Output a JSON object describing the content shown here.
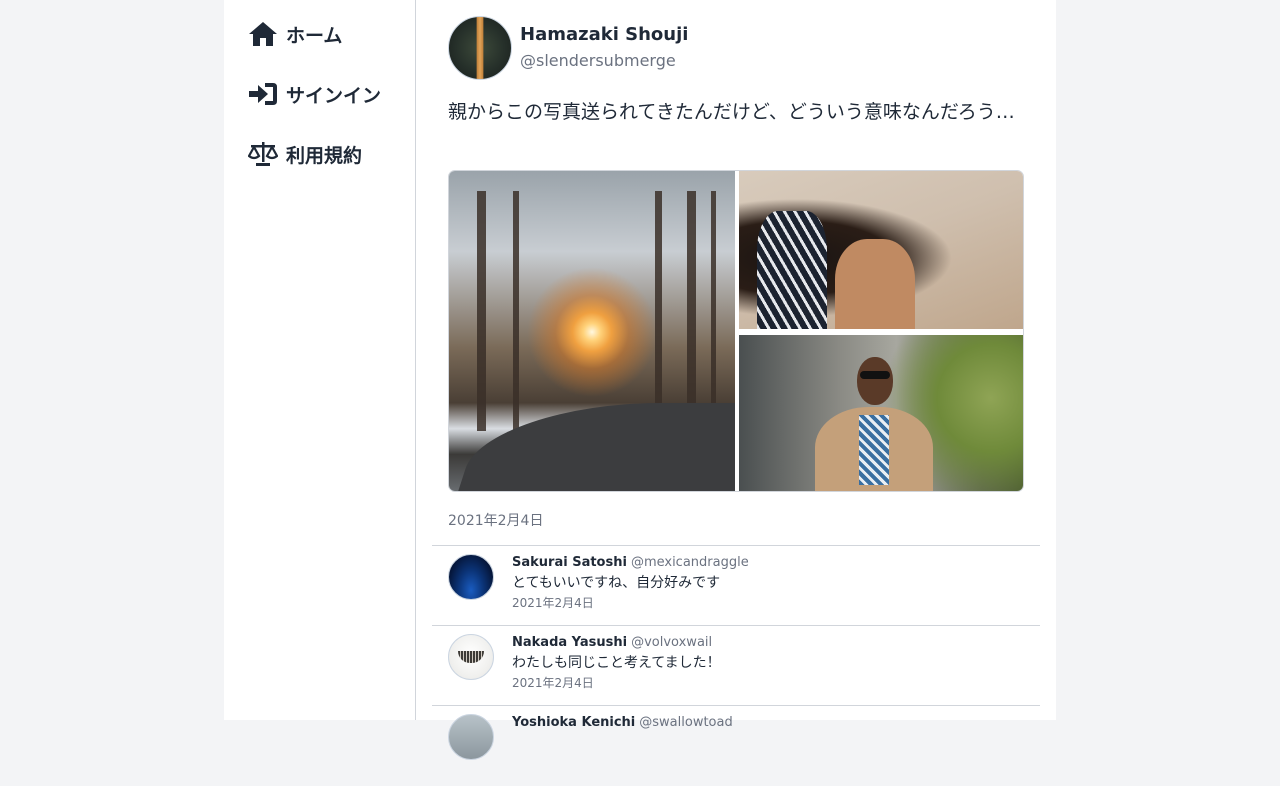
{
  "sidebar": {
    "items": [
      {
        "label": "ホーム",
        "icon": "home-icon"
      },
      {
        "label": "サインイン",
        "icon": "sign-in-icon"
      },
      {
        "label": "利用規約",
        "icon": "scale-icon"
      }
    ]
  },
  "post": {
    "author_name": "Hamazaki Shouji",
    "author_handle": "@slendersubmerge",
    "text": "親からこの写真送られてきたんだけど、どういう意味なんだろう…",
    "date": "2021年2月4日",
    "images": [
      "forest-road-sunlight-photo",
      "woman-hair-desert-photo",
      "man-tan-suit-photo"
    ]
  },
  "replies": [
    {
      "name": "Sakurai Satoshi",
      "handle": "@mexicandraggle",
      "text": "とてもいいですね、自分好みです",
      "date": "2021年2月4日"
    },
    {
      "name": "Nakada Yasushi",
      "handle": "@volvoxwail",
      "text": "わたしも同じこと考えてました！",
      "date": "2021年2月4日"
    },
    {
      "name": "Yoshioka Kenichi",
      "handle": "@swallowtoad",
      "text": "",
      "date": ""
    }
  ],
  "colors": {
    "page_bg": "#f3f4f6",
    "panel_bg": "#ffffff",
    "text_primary": "#1f2937",
    "text_muted": "#6b7280",
    "divider": "#d1d5db"
  }
}
